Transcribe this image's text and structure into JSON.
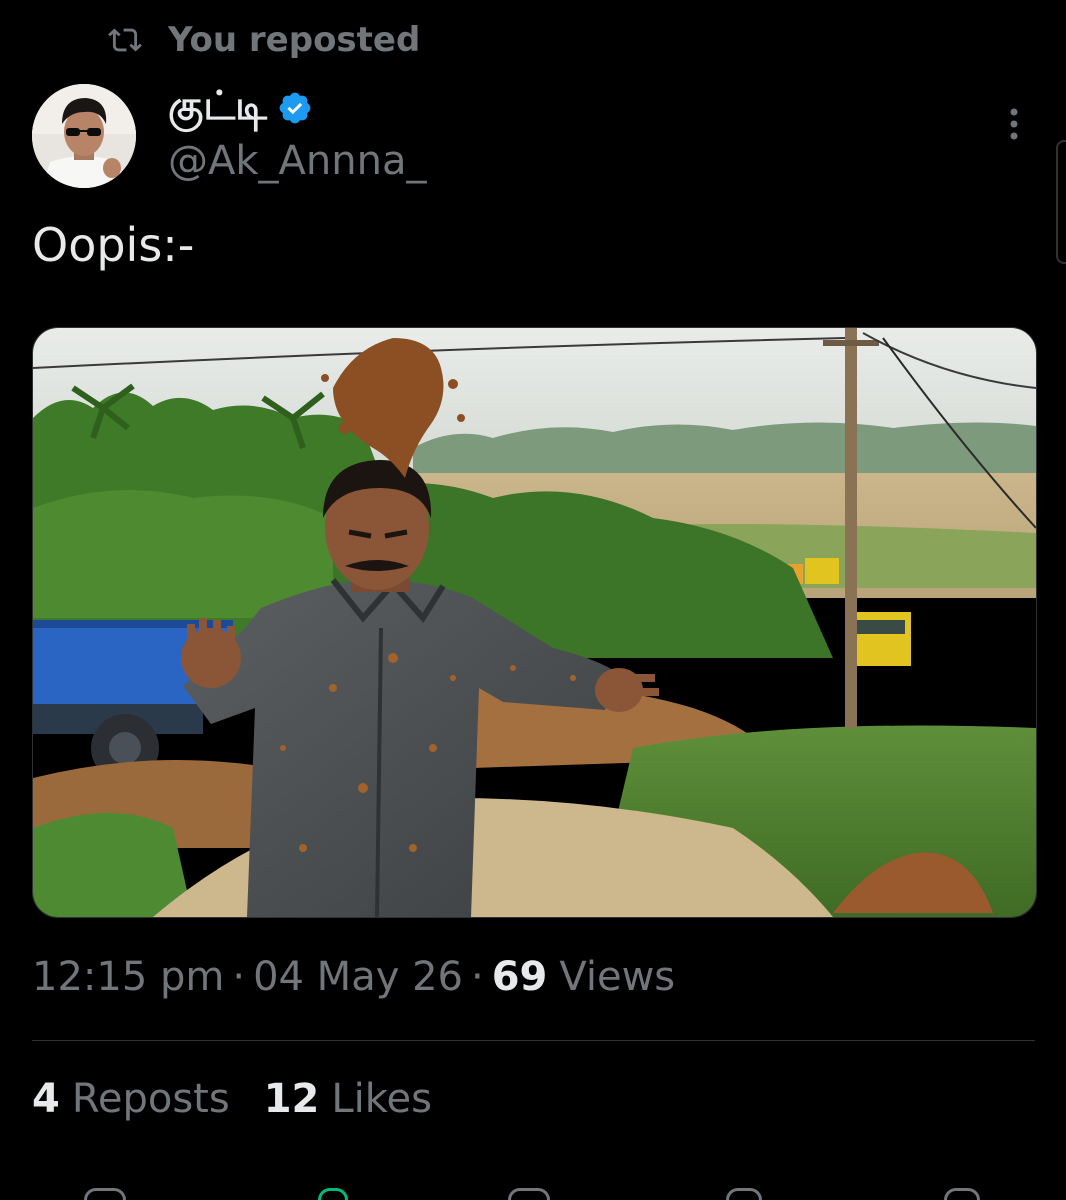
{
  "repost_banner": {
    "icon": "repost-icon",
    "text": "You reposted"
  },
  "author": {
    "display_name": "குட்டி",
    "handle": "@Ak_Annna_",
    "verified": true,
    "verified_color": "#1d9bf0",
    "avatar_icon": "profile-avatar"
  },
  "tweet": {
    "text": "Oopis:-",
    "media_icon": "photo-man-throwing-soil"
  },
  "meta": {
    "time": "12:15 pm",
    "separator": "·",
    "date": "04 May 26",
    "views_count": "69",
    "views_label": "Views"
  },
  "stats": {
    "reposts_count": "4",
    "reposts_label": "Reposts",
    "likes_count": "12",
    "likes_label": "Likes"
  },
  "colors": {
    "background": "#000000",
    "primary_text": "#e7e9ea",
    "secondary_text": "#71767b",
    "divider": "#2f3336",
    "accent": "#1d9bf0"
  }
}
